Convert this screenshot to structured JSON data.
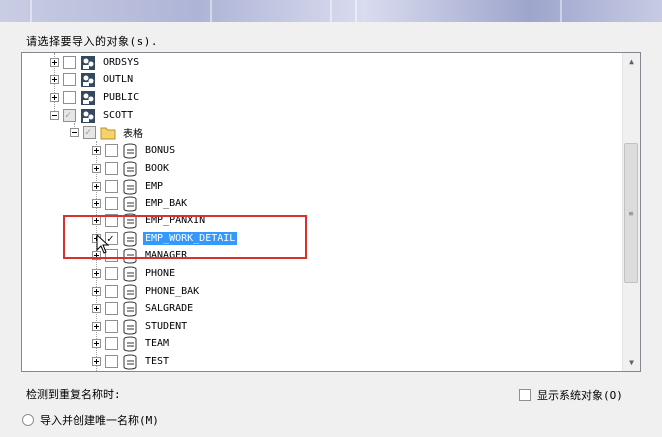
{
  "dialog": {
    "prompt": "请选择要导入的对象(s).",
    "duplicate_label": "检测到重复名称时:",
    "show_system_objects": "显示系统对象(O)",
    "radio_import_unique": "导入并创建唯一名称(M)"
  },
  "tree": {
    "users": [
      {
        "label": "ORDSYS",
        "checked": false
      },
      {
        "label": "OUTLN",
        "checked": false
      },
      {
        "label": "PUBLIC",
        "checked": false
      },
      {
        "label": "SCOTT",
        "checked": "partial",
        "expanded": true
      }
    ],
    "folder": {
      "label": "表格",
      "checked": "partial",
      "expanded": true
    },
    "tables": [
      {
        "label": "BONUS",
        "checked": false
      },
      {
        "label": "BOOK",
        "checked": false
      },
      {
        "label": "EMP",
        "checked": false
      },
      {
        "label": "EMP_BAK",
        "checked": false
      },
      {
        "label": "EMP_PANXIN",
        "checked": false
      },
      {
        "label": "EMP_WORK_DETAIL",
        "checked": true,
        "selected": true
      },
      {
        "label": "MANAGER",
        "checked": false
      },
      {
        "label": "PHONE",
        "checked": false
      },
      {
        "label": "PHONE_BAK",
        "checked": false
      },
      {
        "label": "SALGRADE",
        "checked": false
      },
      {
        "label": "STUDENT",
        "checked": false
      },
      {
        "label": "TEAM",
        "checked": false
      },
      {
        "label": "TEST",
        "checked": false
      }
    ]
  },
  "colors": {
    "selection": "#3399ff",
    "highlight_box": "#d9302c"
  }
}
